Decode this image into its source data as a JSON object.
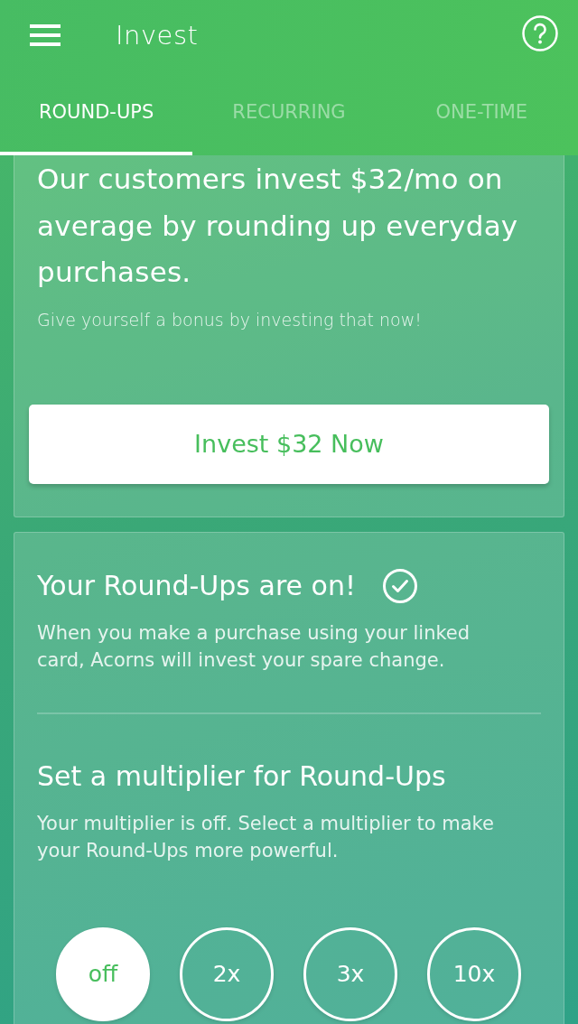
{
  "header": {
    "title": "Invest"
  },
  "tabs": [
    {
      "label": "ROUND-UPS",
      "selected": true
    },
    {
      "label": "RECURRING",
      "selected": false
    },
    {
      "label": "ONE-TIME",
      "selected": false
    }
  ],
  "promo": {
    "headline": "Our customers invest $32/mo on average by rounding up everyday purchases.",
    "subtext": "Give yourself a bonus by investing that now!",
    "button": "Invest $32 Now"
  },
  "round_ups": {
    "title": "Your Round-Ups are on!",
    "description": "When you make a purchase using your linked card, Acorns will invest your spare change."
  },
  "multiplier": {
    "title": "Set a multiplier for Round-Ups",
    "description": "Your multiplier is off. Select a multiplier to make your Round-Ups more powerful.",
    "options": [
      {
        "label": "off",
        "selected": true
      },
      {
        "label": "2x",
        "selected": false
      },
      {
        "label": "3x",
        "selected": false
      },
      {
        "label": "10x",
        "selected": false
      }
    ]
  }
}
